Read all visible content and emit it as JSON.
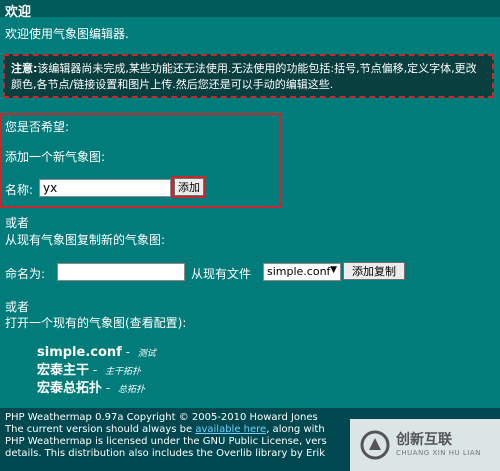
{
  "title": "欢迎",
  "welcome_text": "欢迎使用气象图编辑器.",
  "notice": {
    "label": "注意:",
    "text": "该编辑器尚未完成,某些功能还无法使用.无法使用的功能包括:括号,节点偏移,定义字体,更改颜色,各节点/链接设置和图片上传.然后您还是可以手动的编辑这些."
  },
  "wish_label": "您是否希望:",
  "add_new": {
    "heading": "添加一个新气象图:",
    "name_label": "名称:",
    "name_value": "yx",
    "add_button": "添加"
  },
  "or_1": "或者",
  "copy": {
    "heading": "从现有气象图复制新的气象图:",
    "name_label": "命名为:",
    "name_value": "",
    "from_label": "从现有文件",
    "selected_file": "simple.conf",
    "copy_button": "添加复制"
  },
  "or_2": "或者",
  "open": {
    "heading": "打开一个现有的气象图(查看配置):",
    "maps": [
      {
        "name": "simple.conf",
        "sep": " - ",
        "desc": "测试"
      },
      {
        "name": "宏泰主干",
        "sep": " - ",
        "desc": "主干拓扑"
      },
      {
        "name": "宏泰总拓扑",
        "sep": " - ",
        "desc": "总拓扑"
      }
    ]
  },
  "footer": {
    "line1": "PHP Weathermap 0.97a Copyright © 2005-2010 Howard Jones",
    "line2_pre": "The current version should always be ",
    "line2_link": "available here",
    "line2_post": ", along with",
    "line3": "PHP Weathermap is licensed under the GNU Public License, vers",
    "line4": "details. This distribution also includes the Overlib library by Erik"
  },
  "watermark": {
    "cn": "创新互联",
    "en": "CHUANG XIN HU LIAN"
  }
}
